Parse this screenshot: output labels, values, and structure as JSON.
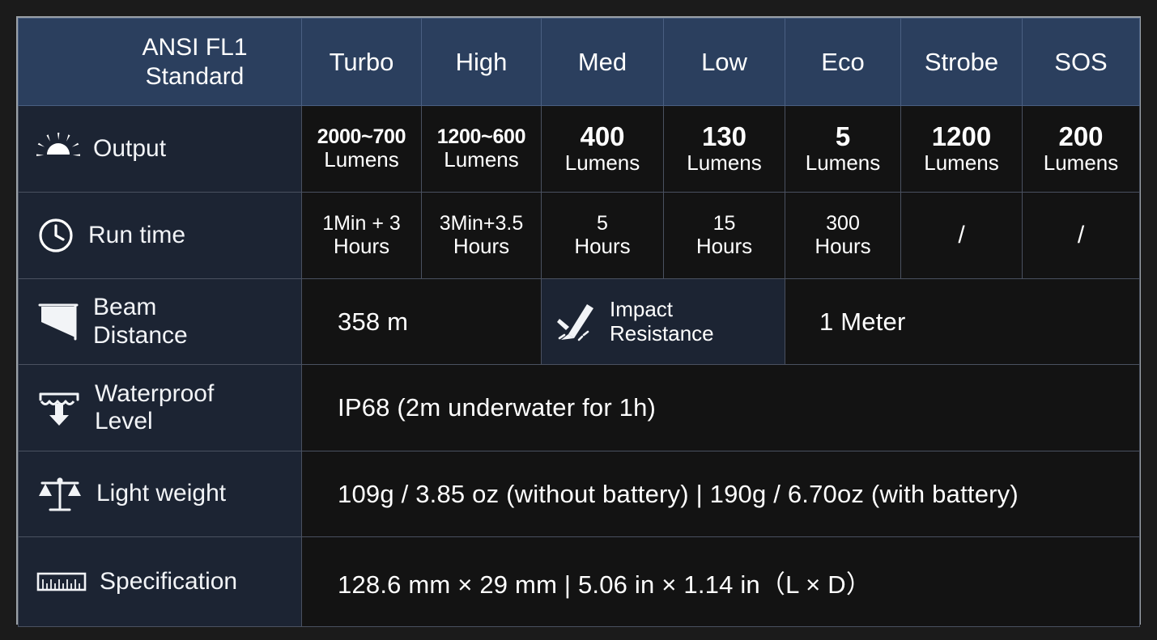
{
  "table": {
    "header": {
      "standard_label": "ANSI FL1\nStandard",
      "standard_line1": "ANSI FL1",
      "standard_line2": "Standard",
      "modes": [
        "Turbo",
        "High",
        "Med",
        "Low",
        "Eco",
        "Strobe",
        "SOS"
      ]
    },
    "rows": [
      {
        "key": "output",
        "label": "Output",
        "icon": "sunburst-icon",
        "values": [
          {
            "amount": "2000~700",
            "unit": "Lumens"
          },
          {
            "amount": "1200~600",
            "unit": "Lumens"
          },
          {
            "amount": "400",
            "unit": "Lumens"
          },
          {
            "amount": "130",
            "unit": "Lumens"
          },
          {
            "amount": "5",
            "unit": "Lumens"
          },
          {
            "amount": "1200",
            "unit": "Lumens"
          },
          {
            "amount": "200",
            "unit": "Lumens"
          }
        ]
      },
      {
        "key": "run_time",
        "label": "Run time",
        "icon": "clock-icon",
        "values": [
          {
            "amount": "1Min + 3",
            "unit": "Hours"
          },
          {
            "amount": "3Min+3.5",
            "unit": "Hours"
          },
          {
            "amount": "5",
            "unit": "Hours"
          },
          {
            "amount": "15",
            "unit": "Hours"
          },
          {
            "amount": "300",
            "unit": "Hours"
          },
          {
            "amount": "/",
            "unit": ""
          },
          {
            "amount": "/",
            "unit": ""
          }
        ]
      },
      {
        "key": "beam_distance",
        "label_line1": "Beam",
        "label_line2": "Distance",
        "icon": "beam-cone-icon",
        "value": "358 m",
        "impact": {
          "icon": "falling-flashlight-icon",
          "label_line1": "Impact",
          "label_line2": "Resistance",
          "value": "1 Meter"
        }
      },
      {
        "key": "waterproof_level",
        "label_line1": "Waterproof",
        "label_line2": "Level",
        "icon": "water-drop-arrow-icon",
        "value": "IP68 (2m underwater for 1h)"
      },
      {
        "key": "light_weight",
        "label": "Light weight",
        "icon": "balance-scale-icon",
        "value": "109g  /  3.85 oz (without battery) | 190g / 6.70oz (with battery)"
      },
      {
        "key": "specification",
        "label": "Specification",
        "icon": "ruler-icon",
        "value": "128.6 mm × 29 mm | 5.06 in × 1.14 in（L × D）"
      }
    ]
  },
  "colors": {
    "header_bg": "#2b3f5e",
    "label_bg": "#1c2433",
    "data_bg": "#131313",
    "page_bg": "#1b1b1b",
    "border": "#4a5160",
    "outer_border": "#9aa0a6",
    "text": "#ffffff"
  }
}
